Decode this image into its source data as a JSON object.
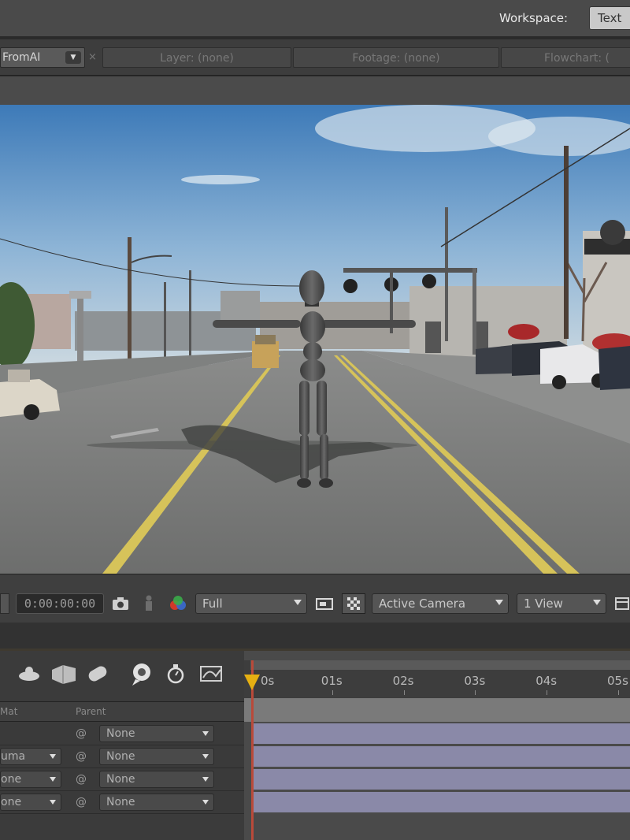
{
  "app": {
    "workspace_label": "Workspace:",
    "workspace_value": "Text"
  },
  "viewer_tabs": {
    "composition": "FromAI",
    "layer": "Layer: (none)",
    "footage": "Footage: (none)",
    "flowchart": "Flowchart: ("
  },
  "viewer_controls": {
    "timecode": "0:00:00:00",
    "resolution": "Full",
    "camera": "Active Camera",
    "views": "1 View"
  },
  "timeline": {
    "columns": {
      "track_matte": "Mat",
      "parent": "Parent"
    },
    "time_labels": [
      "0s",
      "01s",
      "02s",
      "03s",
      "04s",
      "05s"
    ],
    "rows": [
      {
        "matte": "",
        "parent": "None"
      },
      {
        "matte": "uma",
        "parent": "None"
      },
      {
        "matte": "one",
        "parent": "None"
      },
      {
        "matte": "one",
        "parent": "None"
      }
    ],
    "colors": {
      "layer_bar": "#8a89a8",
      "cti": "#e6b012",
      "cti_line": "#b94a3a"
    }
  },
  "icons": [
    "camera-icon",
    "figure-icon",
    "rgb-channels-icon",
    "region-of-interest-icon",
    "transparency-grid-icon",
    "view-layout-icon"
  ]
}
